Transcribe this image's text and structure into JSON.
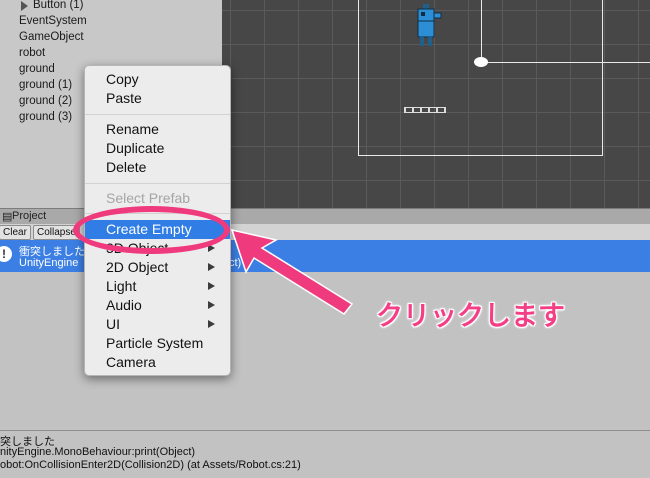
{
  "hierarchy": {
    "items": [
      "Button (1)",
      "EventSystem",
      "GameObject",
      "robot",
      "ground",
      "ground (1)",
      "ground (2)",
      "ground (3)"
    ]
  },
  "tabs": {
    "project": "Project"
  },
  "console_toolbar": {
    "clear": "Clear",
    "collapse": "Collapse"
  },
  "console": {
    "selected_line1": "衝突しました",
    "selected_line2": "UnityEngine",
    "selected_tail": "ct)",
    "detail_lines": [
      "突しました",
      "nityEngine.MonoBehaviour:print(Object)",
      "obot:OnCollisionEnter2D(Collision2D) (at Assets/Robot.cs:21)"
    ]
  },
  "context_menu": {
    "items": [
      {
        "label": "Copy"
      },
      {
        "label": "Paste"
      },
      {
        "label": "Rename"
      },
      {
        "label": "Duplicate"
      },
      {
        "label": "Delete"
      },
      {
        "label": "Select Prefab",
        "disabled": true
      },
      {
        "label": "Create Empty",
        "highlighted": true
      },
      {
        "label": "3D Object",
        "submenu": true
      },
      {
        "label": "2D Object",
        "submenu": true
      },
      {
        "label": "Light",
        "submenu": true
      },
      {
        "label": "Audio",
        "submenu": true
      },
      {
        "label": "UI",
        "submenu": true
      },
      {
        "label": "Particle System"
      },
      {
        "label": "Camera"
      }
    ]
  },
  "annotation": {
    "text": "クリックします",
    "color": "#f43f86"
  },
  "colors": {
    "selection": "#3c7fe4",
    "highlight": "#2f7de5",
    "annotation": "#ef3a7d"
  }
}
